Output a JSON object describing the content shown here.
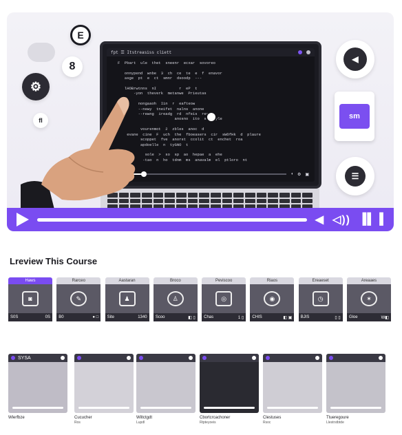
{
  "hero": {
    "screen_title": "fpt   ☰   Itstreasiss   cliett",
    "code_lines": [
      "F  Pbart  ule  thet  sneenr  ecxar  sovoreo",
      "",
      "   onnypend  wnbe  3  ch  ce  te  e  f  enavor",
      "   asge  pt  e  ct  smnr  dsoodp  ---",
      "",
      "   lHOBrwtnns  nI          r  eP  t                    ",
      "       -yon  theverk  metanwe  Prieutas",
      "",
      "         nongaaoh  Iin  r  eafteow",
      "         --newy  tneifet  nalns  anone",
      "         --rewng  ireadg  rd  nfeis  rec",
      "                         anosno  ito  ssspoyle",
      "",
      "          vourenmot  2  zbles  anoc  d",
      "    evane  cine  F  uch  the  fboeasers  cir  sWOfHk  d  plaure",
      "          scoppet  fve  anorst  ccolit  ct  enchet  roa",
      "          apdoelle  n  tyGNO  t",
      "",
      "            sole  >  so  sp  ao  hepae  a  ehe",
      "           -tao  n  ho  tdnm  ms  anavalm  el  ptloro  nt"
    ],
    "deco_badges": [
      "E",
      "8",
      "fl"
    ],
    "tablet_label": "sm"
  },
  "section": {
    "title": "Lreview This Course"
  },
  "modules": [
    {
      "tab": "Haws",
      "active": true,
      "icon": "chat-icon",
      "glyph": "◙",
      "left": "S0S",
      "right": "0S"
    },
    {
      "tab": "Rarceo",
      "active": false,
      "icon": "edit-icon",
      "glyph": "✎",
      "left": "B0",
      "right": "●  □"
    },
    {
      "tab": "Aastaran",
      "active": false,
      "icon": "user-icon",
      "glyph": "♟",
      "left": "Site",
      "right": "1340"
    },
    {
      "tab": "Broco",
      "active": false,
      "icon": "person-icon",
      "glyph": "♙",
      "left": "Scoo",
      "right": "◧  ▯"
    },
    {
      "tab": "Peviscoo",
      "active": false,
      "icon": "target-icon",
      "glyph": "◎",
      "left": "Chas",
      "right": "1  ▯"
    },
    {
      "tab": "Riaos",
      "active": false,
      "icon": "shield-icon",
      "glyph": "◉",
      "left": "CHIS",
      "right": "◧  ▣"
    },
    {
      "tab": "Ereaeset",
      "active": false,
      "icon": "clock-icon",
      "glyph": "◷",
      "left": "BJIS",
      "right": "▯  ▯"
    },
    {
      "tab": "Areaaes",
      "active": false,
      "icon": "star-icon",
      "glyph": "✶",
      "left": "Gloe",
      "right": "W◧"
    }
  ],
  "videos": [
    {
      "top_label": "SYSA",
      "title": "Wlerfbze",
      "sub": ""
    },
    {
      "top_label": "",
      "title": "Cucucher",
      "sub": "Ros"
    },
    {
      "top_label": "",
      "title": "Wiltctgdt",
      "sub": "Lupdl"
    },
    {
      "top_label": "",
      "title": "Cbortcrcachoner",
      "sub": "Rtpteyoeis"
    },
    {
      "top_label": "",
      "title": "Clestuses",
      "sub": "Rsoc"
    },
    {
      "top_label": "",
      "title": "Ttueregoure",
      "sub": "Llestrstbtde"
    }
  ],
  "colors": {
    "accent": "#7a4cf1",
    "dark": "#1b1b22"
  }
}
